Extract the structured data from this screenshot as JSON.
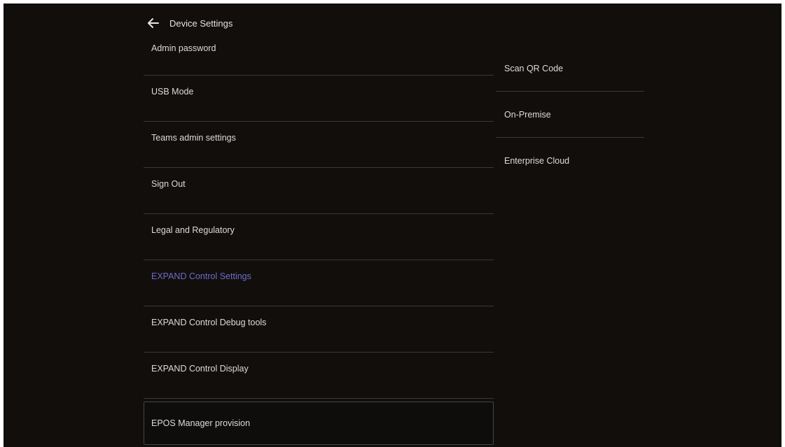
{
  "header": {
    "title": "Device Settings",
    "back_icon": "arrow-left-icon"
  },
  "menu": {
    "items": [
      {
        "label": "Admin password"
      },
      {
        "label": "USB Mode"
      },
      {
        "label": "Teams admin settings"
      },
      {
        "label": "Sign Out"
      },
      {
        "label": "Legal and Regulatory"
      },
      {
        "label": "EXPAND Control Settings"
      },
      {
        "label": "EXPAND Control Debug tools"
      },
      {
        "label": "EXPAND Control Display"
      },
      {
        "label": "EPOS Manager provision"
      }
    ],
    "active_color": "#6d6dc9"
  },
  "submenu": {
    "items": [
      {
        "label": "Scan QR Code"
      },
      {
        "label": "On-Premise"
      },
      {
        "label": "Enterprise Cloud"
      }
    ]
  }
}
